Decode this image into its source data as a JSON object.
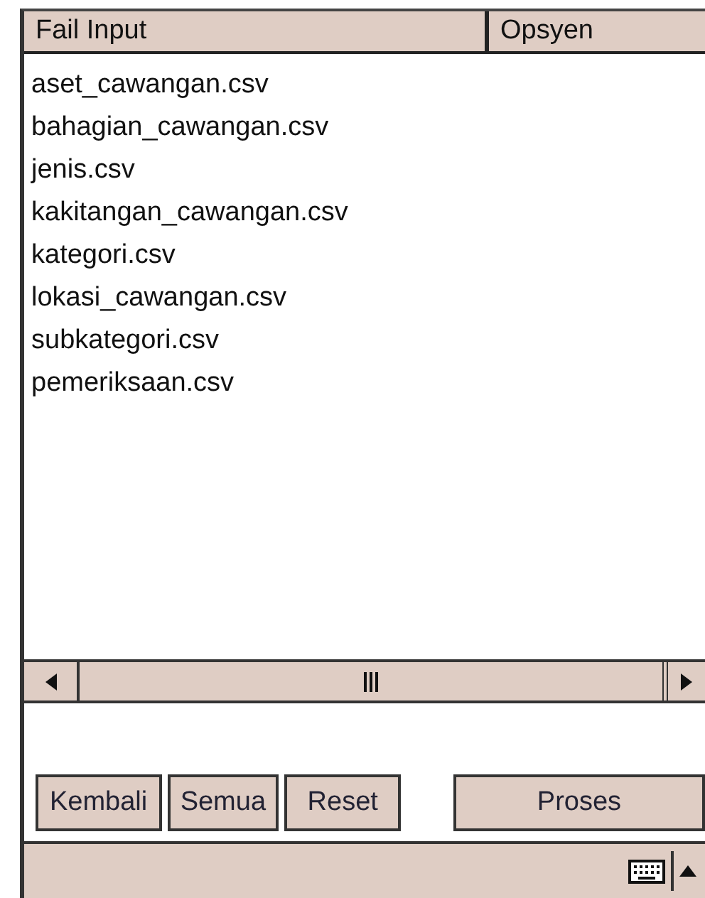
{
  "columns": [
    "Fail Input",
    "Opsyen"
  ],
  "files": [
    "aset_cawangan.csv",
    "bahagian_cawangan.csv",
    "jenis.csv",
    "kakitangan_cawangan.csv",
    "kategori.csv",
    "lokasi_cawangan.csv",
    "subkategori.csv",
    "pemeriksaan.csv"
  ],
  "buttons": [
    "Kembali",
    "Semua",
    "Reset",
    "Proses"
  ]
}
